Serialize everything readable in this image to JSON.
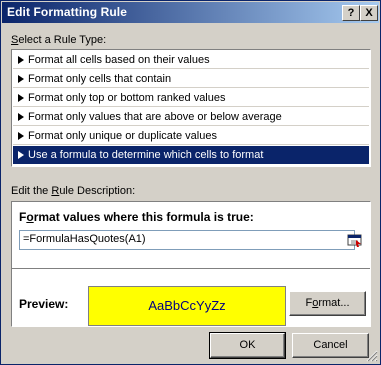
{
  "window": {
    "title": "Edit Formatting Rule"
  },
  "titlebar": {
    "help_label": "?",
    "close_label": "X"
  },
  "rule_type": {
    "label": "Select a Rule Type:",
    "items": [
      "Format all cells based on their values",
      "Format only cells that contain",
      "Format only top or bottom ranked values",
      "Format only values that are above or below average",
      "Format only unique or duplicate values",
      "Use a formula to determine which cells to format"
    ],
    "selected_index": 5
  },
  "description": {
    "label": "Edit the Rule Description:",
    "formula_label": "Format values where this formula is true:",
    "formula_value": "=FormulaHasQuotes(A1)",
    "preview_label": "Preview:",
    "preview_text": "AaBbCcYyZz",
    "preview_fill": "#ffff00",
    "format_button": "Format..."
  },
  "footer": {
    "ok_label": "OK",
    "cancel_label": "Cancel"
  }
}
